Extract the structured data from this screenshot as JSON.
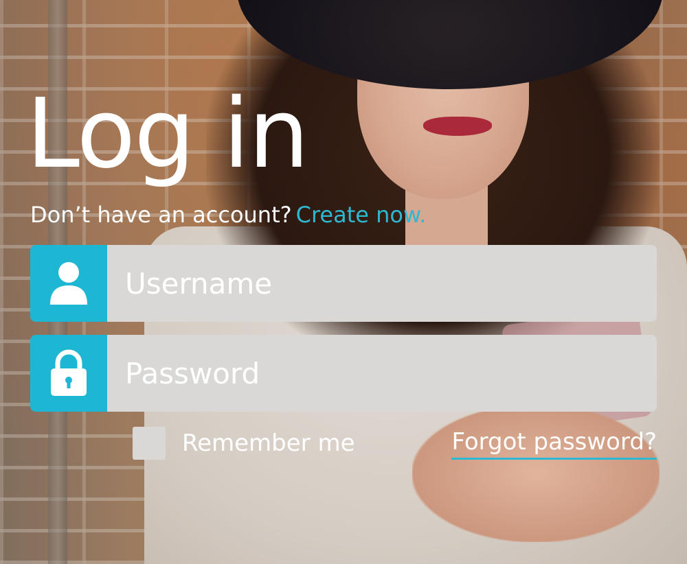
{
  "login": {
    "title": "Log in",
    "signup_prompt": "Don’t have an account?",
    "signup_link": "Create now.",
    "username": {
      "placeholder": "Username",
      "value": "",
      "icon": "user-icon"
    },
    "password": {
      "placeholder": "Password",
      "value": "",
      "icon": "lock-icon"
    },
    "remember_label": "Remember me",
    "remember_checked": false,
    "forgot_label": "Forgot password?"
  },
  "colors": {
    "accent": "#1db6d3",
    "link": "#2fb8d2",
    "field_bg": "#d9d8d7",
    "text": "#ffffff"
  }
}
